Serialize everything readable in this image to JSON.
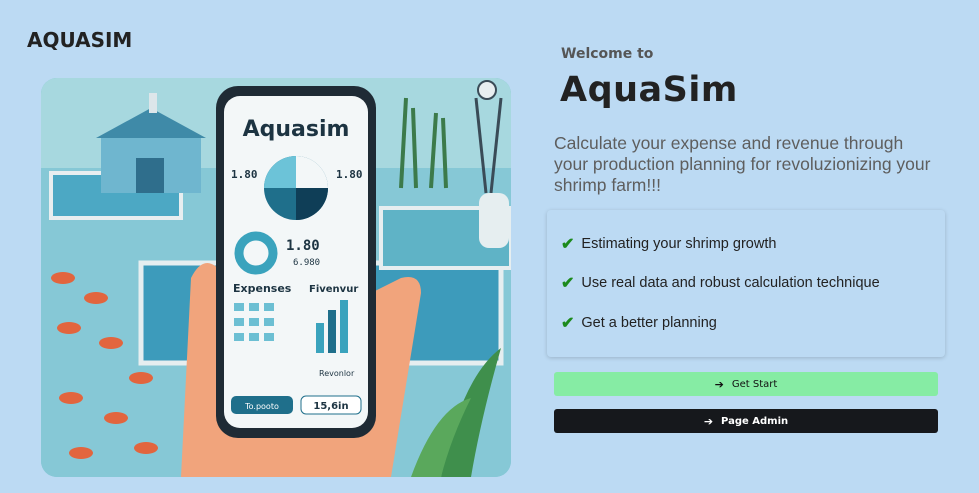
{
  "app": {
    "brand": "AQUASIM"
  },
  "hero": {
    "welcome": "Welcome to",
    "title": "AquaSim",
    "tagline": "Calculate your expense and revenue through your production planning for revoluzionizing your shrimp farm!!!"
  },
  "features": [
    {
      "icon": "check-icon",
      "label": "Estimating your shrimp growth"
    },
    {
      "icon": "check-icon",
      "label": "Use real data and robust calculation technique"
    },
    {
      "icon": "check-icon",
      "label": "Get a better planning"
    }
  ],
  "actions": {
    "start_label": "Get Start",
    "admin_label": "Page Admin"
  },
  "illustration": {
    "phone_title": "Aquasim",
    "stat_a": "1.80",
    "stat_b": "6.980",
    "expenses_label": "Expenses",
    "revenue_label": "Fivenvur",
    "revenue_sub": "Revonlor",
    "footer_left": "To.pooto",
    "footer_right": "15,6in"
  },
  "colors": {
    "background": "#bcdaf3",
    "start_button": "#86eca4",
    "admin_button": "#16181c",
    "check": "#1c8a1c"
  }
}
